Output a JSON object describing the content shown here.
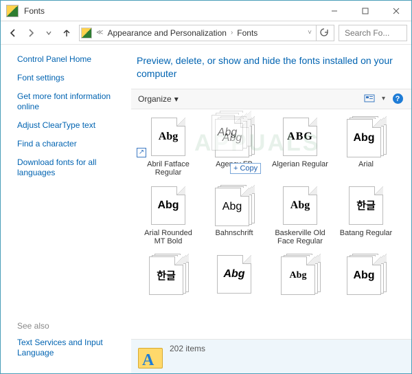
{
  "window": {
    "title": "Fonts"
  },
  "breadcrumb": {
    "level1": "Appearance and Personalization",
    "level2": "Fonts"
  },
  "search": {
    "placeholder": "Search Fo..."
  },
  "sidebar": {
    "home": "Control Panel Home",
    "links": [
      "Font settings",
      "Get more font information online",
      "Adjust ClearType text",
      "Find a character",
      "Download fonts for all languages"
    ],
    "see_also_heading": "See also",
    "see_also": [
      "Text Services and Input Language"
    ]
  },
  "header": {
    "text": "Preview, delete, or show and hide the fonts installed on your computer"
  },
  "toolbar": {
    "organize": "Organize"
  },
  "drag": {
    "tooltip": "+ Copy"
  },
  "fonts": [
    {
      "label": "Abril Fatface Regular",
      "sample": "Abg",
      "style": "fatface",
      "multi": false,
      "shortcut": true
    },
    {
      "label": "Agency FB",
      "sample": "Abg",
      "style": "agency",
      "multi": true
    },
    {
      "label": "Algerian Regular",
      "sample": "ABG",
      "style": "algerian",
      "multi": false
    },
    {
      "label": "Arial",
      "sample": "Abg",
      "style": "arial",
      "multi": true
    },
    {
      "label": "Arial Rounded MT Bold",
      "sample": "Abg",
      "style": "rounded",
      "multi": false
    },
    {
      "label": "Bahnschrift",
      "sample": "Abg",
      "style": "thin",
      "multi": true
    },
    {
      "label": "Baskerville Old Face Regular",
      "sample": "Abg",
      "style": "basker",
      "multi": false
    },
    {
      "label": "Batang Regular",
      "sample": "한글",
      "style": "cjk",
      "multi": false
    },
    {
      "label": "",
      "sample": "한글",
      "style": "cjk",
      "multi": true
    },
    {
      "label": "",
      "sample": "Abg",
      "style": "heavy",
      "multi": false
    },
    {
      "label": "",
      "sample": "Abg",
      "style": "script",
      "multi": true
    },
    {
      "label": "",
      "sample": "Abg",
      "style": "arial",
      "multi": true
    }
  ],
  "status": {
    "count": "202 items"
  },
  "watermark": "APPUALS"
}
